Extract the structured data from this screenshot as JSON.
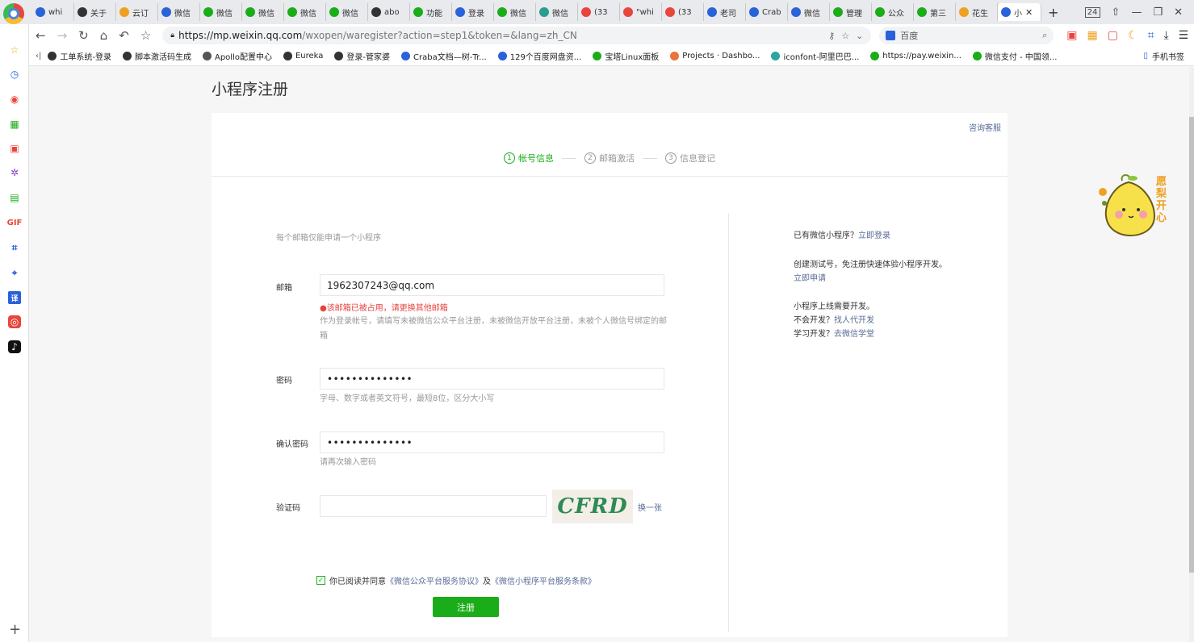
{
  "browser": {
    "tabs": [
      {
        "label": "whi",
        "color": "#2a62d9"
      },
      {
        "label": "关于",
        "color": "#333333"
      },
      {
        "label": "云订",
        "color": "#f0a020"
      },
      {
        "label": "微信",
        "color": "#2a62d9"
      },
      {
        "label": "微信",
        "color": "#1aad19"
      },
      {
        "label": "微信",
        "color": "#1aad19"
      },
      {
        "label": "微信",
        "color": "#1aad19"
      },
      {
        "label": "微信",
        "color": "#1aad19"
      },
      {
        "label": "abo",
        "color": "#333333"
      },
      {
        "label": "功能",
        "color": "#1aad19"
      },
      {
        "label": "登录",
        "color": "#2a62d9"
      },
      {
        "label": "微信",
        "color": "#1aad19"
      },
      {
        "label": "微信",
        "color": "#2a9d8f"
      },
      {
        "label": "(33",
        "color": "#e8453c"
      },
      {
        "label": "\"whi",
        "color": "#e8453c"
      },
      {
        "label": "(33",
        "color": "#e8453c"
      },
      {
        "label": "老司",
        "color": "#2a62d9"
      },
      {
        "label": "Crab",
        "color": "#2a62d9"
      },
      {
        "label": "微信",
        "color": "#2a62d9"
      },
      {
        "label": "管理",
        "color": "#1aad19"
      },
      {
        "label": "公众",
        "color": "#1aad19"
      },
      {
        "label": "第三",
        "color": "#1aad19"
      },
      {
        "label": "花生",
        "color": "#f0a020"
      },
      {
        "label": "小",
        "color": "#2a62d9",
        "active": true
      }
    ],
    "tab_count": "24",
    "url_host": "https://mp.weixin.qq.com",
    "url_path": "/wxopen/waregister?action=step1&token=&lang=zh_CN",
    "search_engine": "百度",
    "bookmarks": [
      {
        "label": "工单系统-登录",
        "color": "#333333"
      },
      {
        "label": "脚本激活码生成",
        "color": "#333333"
      },
      {
        "label": "Apollo配置中心",
        "color": "#555555"
      },
      {
        "label": "Eureka",
        "color": "#333333"
      },
      {
        "label": "登录-管家婆",
        "color": "#333333"
      },
      {
        "label": "Craba文档—树-Tr...",
        "color": "#2a62d9"
      },
      {
        "label": "129个百度网盘资...",
        "color": "#2a62d9"
      },
      {
        "label": "宝塔Linux面板",
        "color": "#1aad19"
      },
      {
        "label": "Projects · Dashbo...",
        "color": "#e8743c"
      },
      {
        "label": "iconfont-阿里巴巴...",
        "color": "#2aa6a0"
      },
      {
        "label": "https://pay.weixin...",
        "color": "#1aad19"
      },
      {
        "label": "微信支付 - 中国领...",
        "color": "#1aad19"
      }
    ],
    "mobile_bookmarks": "手机书签"
  },
  "page": {
    "title": "小程序注册",
    "service_link": "咨询客服",
    "steps": [
      {
        "num": "1",
        "label": "帐号信息",
        "active": true
      },
      {
        "num": "2",
        "label": "邮箱激活",
        "active": false
      },
      {
        "num": "3",
        "label": "信息登记",
        "active": false
      }
    ],
    "tip": "每个邮箱仅能申请一个小程序",
    "email": {
      "label": "邮箱",
      "value": "1962307243@qq.com",
      "error": "●该邮箱已被占用，请更换其他邮箱",
      "hint": "作为登录帐号，请填写未被微信公众平台注册，未被微信开放平台注册，未被个人微信号绑定的邮箱"
    },
    "password": {
      "label": "密码",
      "value": "••••••••••••••",
      "hint": "字母、数字或者英文符号，最短8位，区分大小写"
    },
    "confirm": {
      "label": "确认密码",
      "value": "••••••••••••••",
      "hint": "请再次输入密码"
    },
    "captcha": {
      "label": "验证码",
      "value": "",
      "image_text": "CFRD",
      "refresh": "换一张"
    },
    "agreement": {
      "prefix": "你已阅读并同意",
      "link1": "《微信公众平台服务协议》",
      "middle": "及",
      "link2": "《微信小程序平台服务条款》"
    },
    "submit": "注册",
    "sidebar": {
      "login_q": "已有微信小程序？",
      "login_link": "立即登录",
      "test_text": "创建测试号，免注册快速体验小程序开发。",
      "test_link": "立即申请",
      "dev_line1": "小程序上线需要开发。",
      "dev_q": "不会开发？",
      "dev_link": "找人代开发",
      "learn_q": "学习开发？",
      "learn_link": "去微信学堂"
    },
    "mascot_text": "愿梨开心"
  },
  "colors": {
    "accent": "#1aad19",
    "link": "#576b95",
    "error": "#e64340"
  }
}
